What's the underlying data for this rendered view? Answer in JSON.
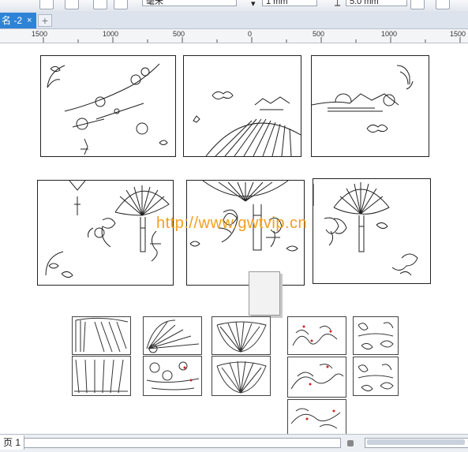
{
  "toolbar": {
    "unit_dropdown": "毫米",
    "field_1": "1 mm",
    "duplicate_distance": "5.0 mm"
  },
  "tabs": {
    "active_label": "名 -2",
    "close_glyph": "×",
    "add_glyph": "+"
  },
  "ruler": {
    "labels": [
      "1500",
      "1000",
      "500",
      "0",
      "500",
      "1000",
      "1500"
    ]
  },
  "watermark": "http://www.gwtvip.cn",
  "status": {
    "page_tab": "页 1"
  },
  "colors": {
    "tab_active": "#2e83d6",
    "watermark": "#f0a020",
    "ink": "#222222",
    "accent_red": "#d22222"
  },
  "icons": [
    "new-doc-icon",
    "open-icon",
    "import-icon",
    "export-icon",
    "duplicate-distance-icon",
    "options-icon"
  ]
}
